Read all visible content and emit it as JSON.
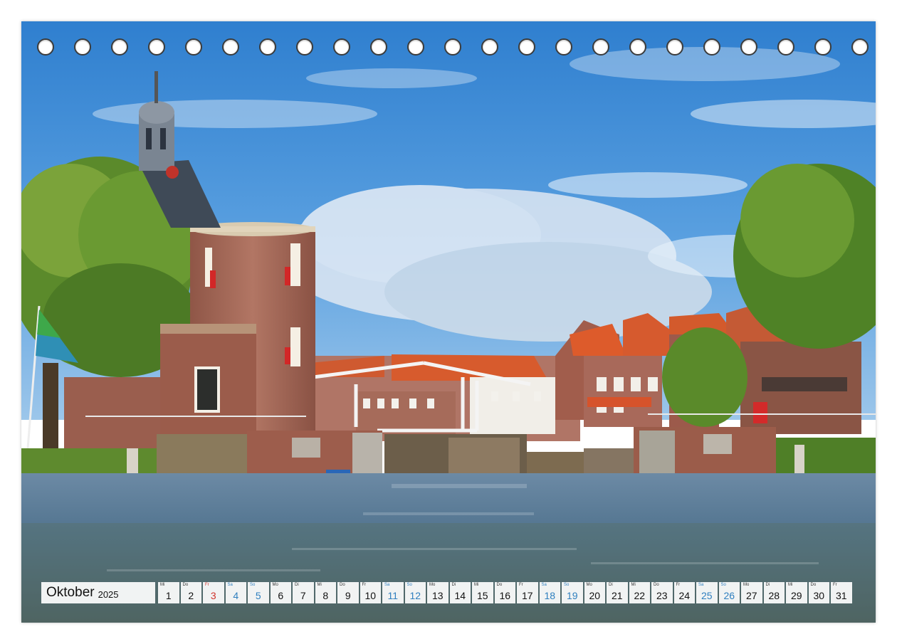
{
  "calendar": {
    "month": "Oktober",
    "year": "2025",
    "days": [
      {
        "wd": "Mi",
        "num": "1",
        "type": "normal"
      },
      {
        "wd": "Do",
        "num": "2",
        "type": "normal"
      },
      {
        "wd": "Fr",
        "num": "3",
        "type": "holiday"
      },
      {
        "wd": "Sa",
        "num": "4",
        "type": "weekend"
      },
      {
        "wd": "So",
        "num": "5",
        "type": "weekend"
      },
      {
        "wd": "Mo",
        "num": "6",
        "type": "normal"
      },
      {
        "wd": "Di",
        "num": "7",
        "type": "normal"
      },
      {
        "wd": "Mi",
        "num": "8",
        "type": "normal"
      },
      {
        "wd": "Do",
        "num": "9",
        "type": "normal"
      },
      {
        "wd": "Fr",
        "num": "10",
        "type": "normal"
      },
      {
        "wd": "Sa",
        "num": "11",
        "type": "weekend"
      },
      {
        "wd": "So",
        "num": "12",
        "type": "weekend"
      },
      {
        "wd": "Mo",
        "num": "13",
        "type": "normal"
      },
      {
        "wd": "Di",
        "num": "14",
        "type": "normal"
      },
      {
        "wd": "Mi",
        "num": "15",
        "type": "normal"
      },
      {
        "wd": "Do",
        "num": "16",
        "type": "normal"
      },
      {
        "wd": "Fr",
        "num": "17",
        "type": "normal"
      },
      {
        "wd": "Sa",
        "num": "18",
        "type": "weekend"
      },
      {
        "wd": "So",
        "num": "19",
        "type": "weekend"
      },
      {
        "wd": "Mo",
        "num": "20",
        "type": "normal"
      },
      {
        "wd": "Di",
        "num": "21",
        "type": "normal"
      },
      {
        "wd": "Mi",
        "num": "22",
        "type": "normal"
      },
      {
        "wd": "Do",
        "num": "23",
        "type": "normal"
      },
      {
        "wd": "Fr",
        "num": "24",
        "type": "normal"
      },
      {
        "wd": "Sa",
        "num": "25",
        "type": "weekend"
      },
      {
        "wd": "So",
        "num": "26",
        "type": "weekend"
      },
      {
        "wd": "Mo",
        "num": "27",
        "type": "normal"
      },
      {
        "wd": "Di",
        "num": "28",
        "type": "normal"
      },
      {
        "wd": "Mi",
        "num": "29",
        "type": "normal"
      },
      {
        "wd": "Do",
        "num": "30",
        "type": "normal"
      },
      {
        "wd": "Fr",
        "num": "31",
        "type": "normal"
      }
    ]
  },
  "binding": {
    "hole_count": 23
  },
  "colors": {
    "sky": "#3d8ad6",
    "brick": "#a8675a",
    "roof": "#d9532c",
    "water": "#5a7d9a",
    "tree": "#5a8a2c",
    "weekend": "#2f7fbf",
    "holiday": "#d0332b"
  }
}
